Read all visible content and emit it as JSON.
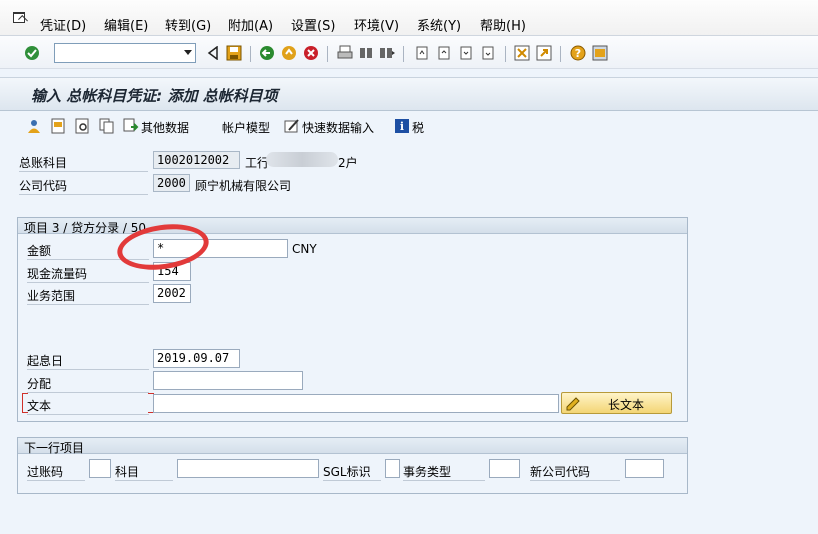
{
  "menubar": {
    "items": [
      "凭证(D)",
      "编辑(E)",
      "转到(G)",
      "附加(A)",
      "设置(S)",
      "环境(V)",
      "系统(Y)",
      "帮助(H)"
    ]
  },
  "toolbar": {
    "command_value": "",
    "icons": [
      "enter-icon",
      "back-icon",
      "save-icon",
      "green-back-icon",
      "exit-icon",
      "cancel-icon",
      "print-icon",
      "find-icon",
      "find-next-icon",
      "first-page-icon",
      "prev-page-icon",
      "next-page-icon",
      "last-page-icon",
      "new-session-icon",
      "shortcut-icon",
      "help-icon",
      "layout-icon"
    ]
  },
  "title": "输入 总帐科目凭证: 添加 总帐科目项",
  "app_toolbar": {
    "other_data": "其他数据",
    "account_model": "帐户模型",
    "fast_entry": "快速数据输入",
    "tax": "税"
  },
  "header": {
    "gl_account_label": "总账科目",
    "gl_account_value": "1002012002",
    "gl_account_desc_prefix": "工行",
    "gl_account_desc_suffix": "2户",
    "company_code_label": "公司代码",
    "company_code_value": "2000",
    "company_name": "顾宁机械有限公司"
  },
  "item_group": {
    "title": "项目 3 / 贷方分录 / 50",
    "amount_label": "金额",
    "amount_value": "*",
    "currency": "CNY",
    "cashflow_label": "现金流量码",
    "cashflow_value": "154",
    "business_area_label": "业务范围",
    "business_area_value": "2002",
    "value_date_label": "起息日",
    "value_date_value": "2019.09.07",
    "assignment_label": "分配",
    "assignment_value": "",
    "text_label": "文本",
    "text_value": "",
    "long_text_button": "长文本"
  },
  "next_group": {
    "title": "下一行项目",
    "posting_key_label": "过账码",
    "account_label": "科目",
    "sgl_label": "SGL标识",
    "transaction_type_label": "事务类型",
    "new_company_code_label": "新公司代码"
  },
  "colors": {
    "background": "#eef4fb",
    "annotation_red": "#e23a3a",
    "button_yellow": "#f3d575"
  }
}
